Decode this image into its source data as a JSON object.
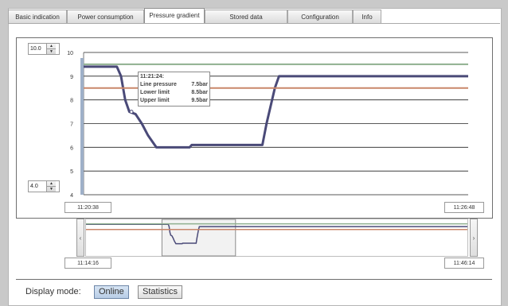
{
  "tabs": [
    {
      "label": "Basic indication"
    },
    {
      "label": "Power consumption"
    },
    {
      "label": "Pressure gradient"
    },
    {
      "label": "Stored data"
    },
    {
      "label": "Configuration"
    },
    {
      "label": "Info"
    }
  ],
  "active_tab": "Pressure gradient",
  "y_max_spinner": "10.0",
  "y_min_spinner": "4.0",
  "time_start": "11:20:38",
  "time_end": "11:26:48",
  "overview_start": "11:14:16",
  "overview_end": "11:46:14",
  "tooltip": {
    "time": "11:21:24:",
    "line_label": "Line pressure",
    "line_value": "7.5bar",
    "lower_label": "Lower limit",
    "lower_value": "8.5bar",
    "upper_label": "Upper limit",
    "upper_value": "9.5bar"
  },
  "display_mode": {
    "label": "Display mode:",
    "online": "Online",
    "statistics": "Statistics",
    "selected": "Online"
  },
  "nav": {
    "left": "‹",
    "right": "›"
  },
  "colors": {
    "line_pressure": "#4a4a78",
    "lower_limit": "#c9876a",
    "upper_limit": "#8fb08f",
    "selection_bar": "#9eb0c8"
  },
  "chart_data": {
    "type": "line",
    "ylim": [
      4,
      10
    ],
    "yticks": [
      "10",
      "9",
      "8",
      "7",
      "6",
      "5",
      "4"
    ],
    "xlim": [
      "11:20:38",
      "11:26:48"
    ],
    "series": [
      {
        "name": "Line pressure",
        "x": [
          "11:20:38",
          "11:21:10",
          "11:21:14",
          "11:21:18",
          "11:21:22",
          "11:21:28",
          "11:21:34",
          "11:21:40",
          "11:21:48",
          "11:22:20",
          "11:22:22",
          "11:23:30",
          "11:23:34",
          "11:23:42",
          "11:23:46",
          "11:26:48"
        ],
        "values": [
          9.4,
          9.4,
          9.0,
          8.0,
          7.5,
          7.4,
          7.0,
          6.5,
          6.0,
          6.0,
          6.1,
          6.1,
          7.0,
          8.5,
          9.0,
          9.0
        ]
      },
      {
        "name": "Lower limit",
        "x": [
          "11:20:38",
          "11:26:48"
        ],
        "values": [
          8.5,
          8.5
        ]
      },
      {
        "name": "Upper limit",
        "x": [
          "11:20:38",
          "11:26:48"
        ],
        "values": [
          9.5,
          9.5
        ]
      }
    ]
  }
}
